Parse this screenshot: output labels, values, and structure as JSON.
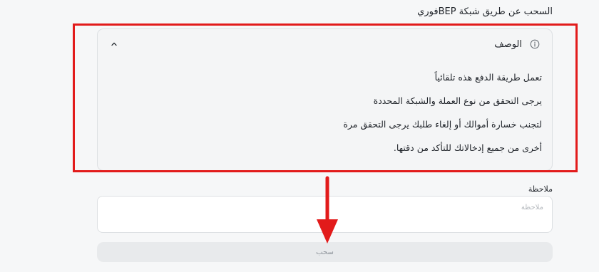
{
  "page": {
    "header": "السحب عن طريق شبكة BEPفوري"
  },
  "description": {
    "title": "الوصف",
    "lines": [
      "تعمل طريقة الدفع هذه تلقائياً",
      "يرجى التحقق من نوع العملة والشبكة المحددة",
      "لتجنب خسارة أموالك أو إلغاء طلبك يرجى التحقق مرة",
      "أخرى من جميع إدخالاتك للتأكد من دقتها."
    ],
    "info_icon": "info-icon",
    "toggle_icon": "chevron-up-icon"
  },
  "note": {
    "label": "ملاحظة",
    "placeholder": "ملاحظة",
    "value": ""
  },
  "actions": {
    "withdraw_label": "سحب"
  },
  "annotation": {
    "highlight_color": "#e21b1b"
  }
}
